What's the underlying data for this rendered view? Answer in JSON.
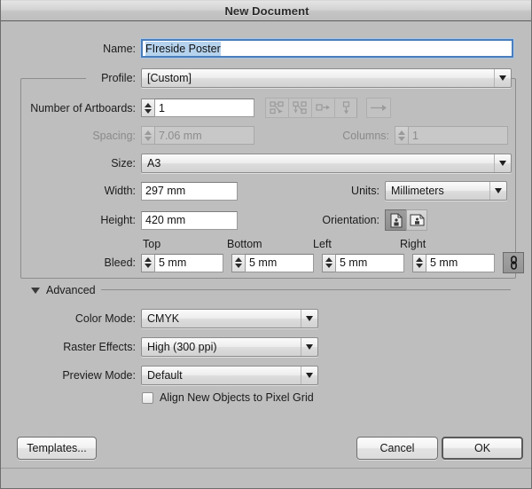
{
  "window": {
    "title": "New Document"
  },
  "fields": {
    "name": {
      "label": "Name:",
      "value": "FIreside Poster",
      "selected": true
    },
    "profile": {
      "label": "Profile:",
      "value": "[Custom]"
    },
    "artboards": {
      "label": "Number of Artboards:",
      "value": "1",
      "layout_icons": [
        "grid-by-row-icon",
        "grid-by-column-icon",
        "arrange-right-icon",
        "arrange-down-icon"
      ],
      "flow_icon": "right-arrow-icon"
    },
    "spacing": {
      "label": "Spacing:",
      "value": "7.06 mm",
      "disabled": true
    },
    "columns": {
      "label": "Columns:",
      "value": "1",
      "disabled": true
    },
    "size": {
      "label": "Size:",
      "value": "A3"
    },
    "width": {
      "label": "Width:",
      "value": "297 mm"
    },
    "height": {
      "label": "Height:",
      "value": "420 mm"
    },
    "units": {
      "label": "Units:",
      "value": "Millimeters"
    },
    "orientation": {
      "label": "Orientation:",
      "portrait_icon": "page-portrait-icon",
      "landscape_icon": "page-landscape-icon",
      "selected": "portrait"
    },
    "bleed": {
      "label": "Bleed:",
      "headers": {
        "top": "Top",
        "bottom": "Bottom",
        "left": "Left",
        "right": "Right"
      },
      "top": "5 mm",
      "bottom": "5 mm",
      "left": "5 mm",
      "right": "5 mm",
      "link_icon": "chain-link-icon",
      "linked": true
    }
  },
  "advanced": {
    "label": "Advanced",
    "expanded": true,
    "color_mode": {
      "label": "Color Mode:",
      "value": "CMYK"
    },
    "raster_effects": {
      "label": "Raster Effects:",
      "value": "High (300 ppi)"
    },
    "preview_mode": {
      "label": "Preview Mode:",
      "value": "Default"
    },
    "align_pixel_grid": {
      "label": "Align New Objects to Pixel Grid",
      "checked": false
    }
  },
  "buttons": {
    "templates": "Templates...",
    "cancel": "Cancel",
    "ok": "OK"
  },
  "colors": {
    "dialog_bg": "#bebebe",
    "selection_blue": "#b6d3ee",
    "focus_border": "#4a7ebb",
    "text": "#1a1a1a",
    "disabled_text": "#8a8a8a"
  }
}
